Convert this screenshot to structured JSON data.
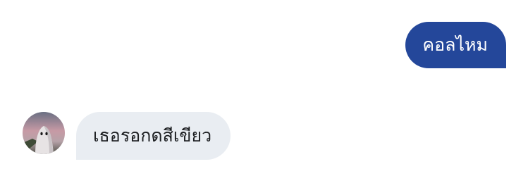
{
  "conversation": {
    "outgoing": {
      "text": "คอลไหม",
      "color": "#24479a"
    },
    "incoming": {
      "text": "เธอรอกดสีเขียว",
      "color": "#e9edf2",
      "avatar_icon": "ghost-avatar"
    }
  }
}
